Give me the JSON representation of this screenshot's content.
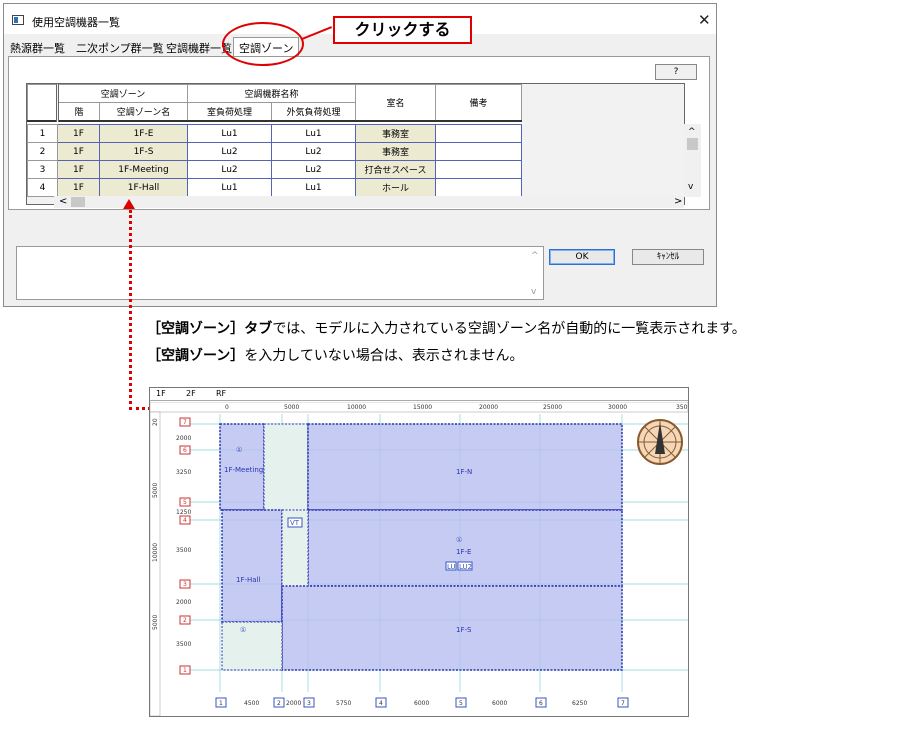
{
  "window": {
    "title": "使用空調機器一覧",
    "close_glyph": "✕",
    "tabs": [
      "熱源群一覧",
      "二次ポンプ群一覧",
      "空調機群一覧",
      "空調ゾーン"
    ],
    "help_label": "?",
    "ok_label": "OK",
    "cancel_label": "ｷｬﾝｾﾙ",
    "scroll_left": "<",
    "scroll_right": ">",
    "scroll_up": "^",
    "scroll_down": "v"
  },
  "callout": "クリックする",
  "table": {
    "group_headers": {
      "zone": "空調ゾーン",
      "ac_name": "空調機群名称",
      "room": "室名",
      "remarks": "備考"
    },
    "sub_headers": {
      "floor": "階",
      "zone_name": "空調ゾーン名",
      "indoor": "室負荷処理",
      "outdoor": "外気負荷処理"
    },
    "rows": [
      {
        "no": "1",
        "floor": "1F",
        "zone": "1F-E",
        "indoor": "Lu1",
        "outdoor": "Lu1",
        "room": "事務室",
        "remarks": ""
      },
      {
        "no": "2",
        "floor": "1F",
        "zone": "1F-S",
        "indoor": "Lu2",
        "outdoor": "Lu2",
        "room": "事務室",
        "remarks": ""
      },
      {
        "no": "3",
        "floor": "1F",
        "zone": "1F-Meeting",
        "indoor": "Lu2",
        "outdoor": "Lu2",
        "room": "打合せスペース",
        "remarks": ""
      },
      {
        "no": "4",
        "floor": "1F",
        "zone": "1F-Hall",
        "indoor": "Lu1",
        "outdoor": "Lu1",
        "room": "ホール",
        "remarks": ""
      }
    ]
  },
  "notes": {
    "line1_bold": "［空調ゾーン］タブ",
    "line1_rest": "では、モデルに入力されている空調ゾーン名が自動的に一覧表示されます。",
    "line2_bold": "［空調ゾーン］",
    "line2_rest": "を入力していない場合は、表示されません。"
  },
  "plan": {
    "floor_tabs": [
      "1F",
      "2F",
      "RF"
    ],
    "ruler_top": [
      "0",
      "5000",
      "10000",
      "15000",
      "20000",
      "25000",
      "30000",
      "350"
    ],
    "ruler_left": [
      "20",
      "5000",
      "10000",
      "5000"
    ],
    "row_markers": [
      "7",
      "6",
      "5",
      "4",
      "3",
      "2",
      "1"
    ],
    "row_dims": [
      "2000",
      "3250",
      "1250",
      "3500",
      "2000",
      "3500"
    ],
    "col_markers": [
      "1",
      "2",
      "3",
      "4",
      "5",
      "6",
      "7"
    ],
    "col_dims": [
      "4500",
      "2000",
      "5750",
      "6000",
      "6000",
      "6250"
    ],
    "zones": {
      "meeting": "1F-Meeting",
      "north": "1F-N",
      "east": "1F-E",
      "hall": "1F-Hall",
      "south": "1F-S"
    },
    "tags": {
      "vt": "VT",
      "lu": "LU",
      "lu2": "LU2",
      "num1": "①"
    }
  },
  "colors": {
    "accent_red": "#e00000",
    "zone_fill": "#b8bef0",
    "zone_line": "#2a33b0",
    "grid_line": "#7fd3d3",
    "cell_yellow": "#ecebd2"
  }
}
